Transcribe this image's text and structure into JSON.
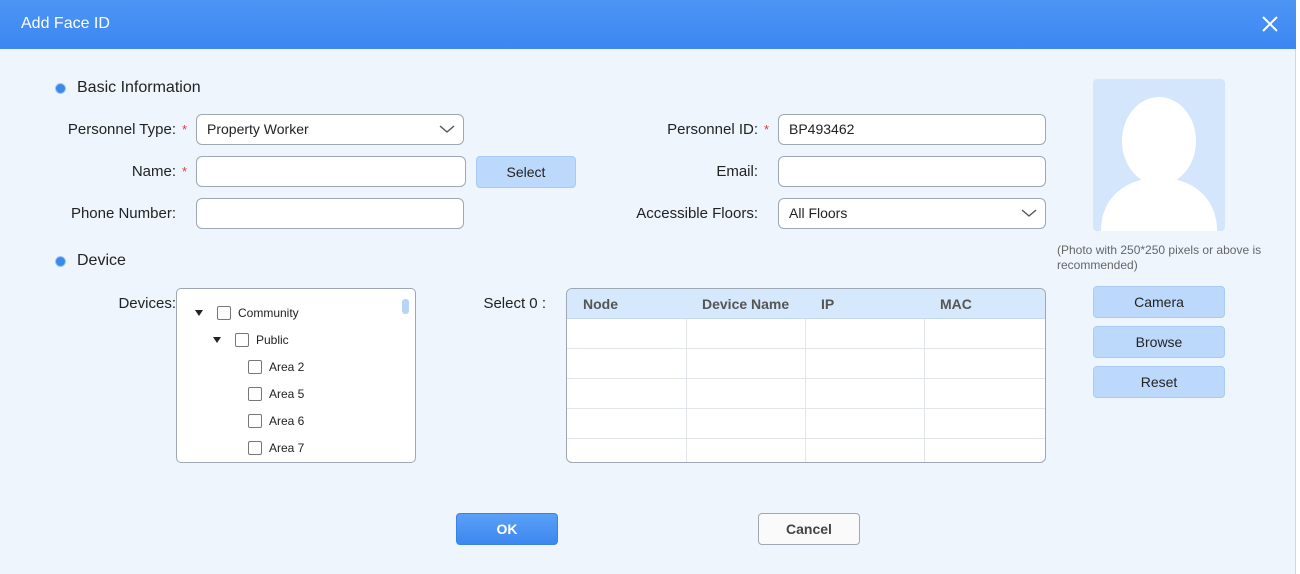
{
  "dialog": {
    "title": "Add Face ID"
  },
  "sections": {
    "basic": "Basic Information",
    "device": "Device"
  },
  "form": {
    "personnel_type": {
      "label": "Personnel Type:",
      "value": "Property Worker"
    },
    "personnel_id": {
      "label": "Personnel ID:",
      "value": "BP493462"
    },
    "name": {
      "label": "Name:",
      "value": "",
      "select_label": "Select"
    },
    "email": {
      "label": "Email:",
      "value": ""
    },
    "phone": {
      "label": "Phone Number:",
      "value": ""
    },
    "floors": {
      "label": "Accessible Floors:",
      "value": "All Floors"
    },
    "required_mark": "*"
  },
  "devices": {
    "label": "Devices:",
    "tree": [
      {
        "label": "Community"
      },
      {
        "label": "Public"
      },
      {
        "label": "Area 2"
      },
      {
        "label": "Area 5"
      },
      {
        "label": "Area 6"
      },
      {
        "label": "Area 7"
      }
    ],
    "select_count_label": "Select 0 :",
    "table_headers": [
      "Node",
      "Device Name",
      "IP",
      "MAC"
    ]
  },
  "photo": {
    "note": "(Photo with 250*250 pixels or above is recommended)",
    "camera_label": "Camera",
    "browse_label": "Browse",
    "reset_label": "Reset"
  },
  "footer": {
    "ok_label": "OK",
    "cancel_label": "Cancel"
  },
  "colors": {
    "titlebar": "#4d95f5",
    "accent": "#3a8ae8",
    "required": "#e03a3a"
  }
}
